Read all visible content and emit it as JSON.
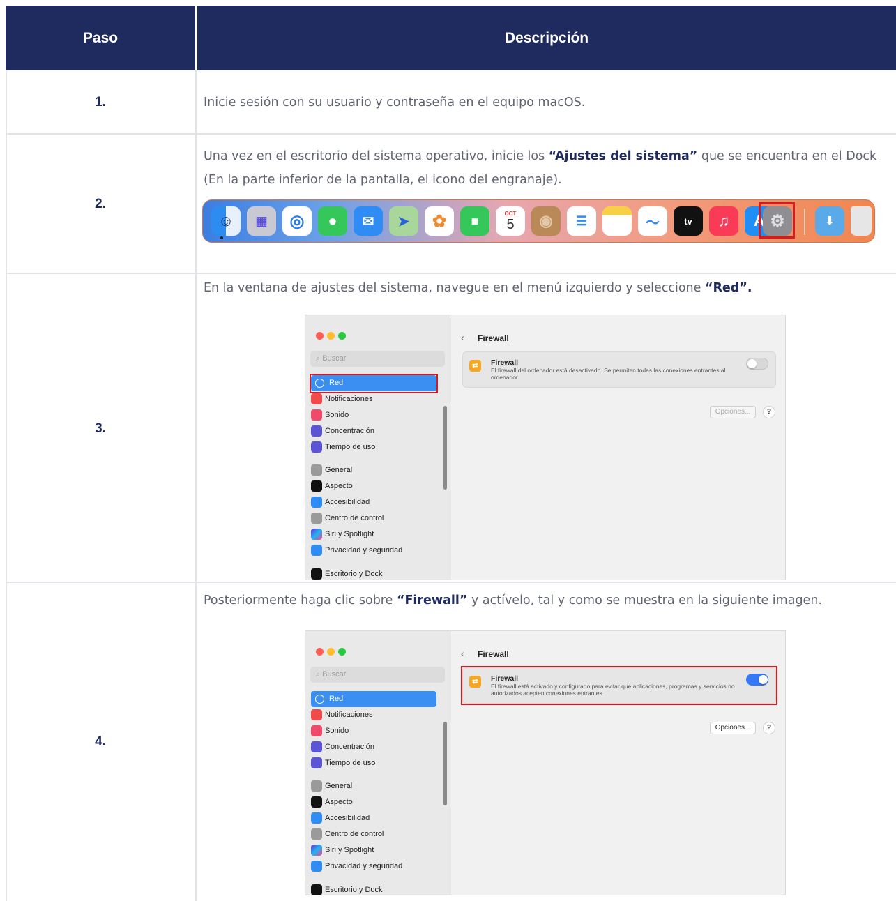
{
  "header": {
    "col_step": "Paso",
    "col_desc": "Descripción"
  },
  "rows": [
    {
      "step": "1.",
      "desc": "Inicie sesión con su usuario y contraseña en el equipo macOS."
    },
    {
      "step": "2.",
      "desc_pre": "Una vez en el escritorio del sistema operativo, inicie los ",
      "desc_bold": "“Ajustes del sistema”",
      "desc_post": " que se encuentra en el Dock (En la parte inferior de la pantalla, el icono del engranaje)."
    },
    {
      "step": "3.",
      "desc_pre": "En la ventana de ajustes del sistema, navegue en el menú izquierdo y seleccione ",
      "desc_bold": "“Red”."
    },
    {
      "step": "4.",
      "desc_pre": "Posteriormente haga clic sobre ",
      "desc_bold": "“Firewall”",
      "desc_post": " y actívelo, tal y como se muestra en la siguiente imagen."
    }
  ],
  "dock": {
    "calendar_month": "OCT",
    "calendar_day": "5",
    "tv_label": "tv",
    "icons": [
      "finder-icon",
      "launchpad-icon",
      "safari-icon",
      "messages-icon",
      "mail-icon",
      "maps-icon",
      "photos-icon",
      "facetime-icon",
      "calendar-icon",
      "contacts-icon",
      "reminders-icon",
      "notes-icon",
      "freeform-icon",
      "apple-tv-icon",
      "music-icon",
      "app-store-icon",
      "system-settings-icon",
      "downloads-folder-icon",
      "trash-icon"
    ]
  },
  "settings": {
    "search_placeholder": "Buscar",
    "selected": "Red",
    "sidebar_items": [
      "Notificaciones",
      "Sonido",
      "Concentración",
      "Tiempo de uso",
      "General",
      "Aspecto",
      "Accesibilidad",
      "Centro de control",
      "Siri y Spotlight",
      "Privacidad y seguridad",
      "Escritorio y Dock"
    ],
    "page_title": "Firewall",
    "firewall_title": "Firewall",
    "desc_off": "El firewall del ordenador está desactivado. Se permiten todas las conexiones entrantes al ordenador.",
    "desc_on": "El firewall está activado y configurado para evitar que aplicaciones, programas y servicios no autorizados acepten conexiones entrantes.",
    "options_label": "Opciones...",
    "help_label": "?"
  },
  "colors": {
    "header_bg": "#1f2a5e",
    "highlight": "#d71920",
    "selected": "#3b8ff3"
  }
}
